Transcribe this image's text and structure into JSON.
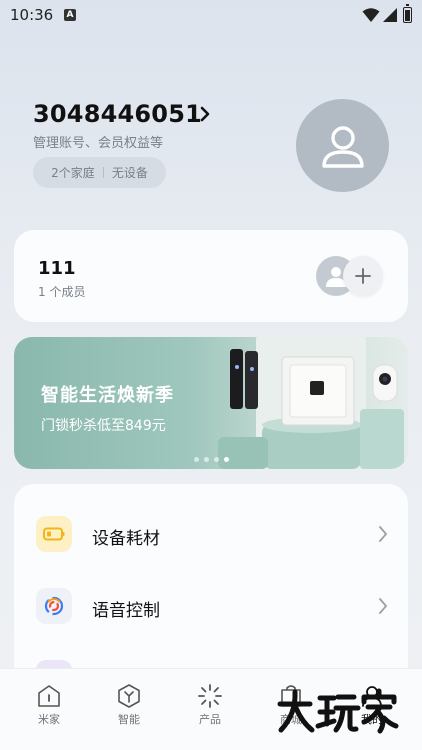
{
  "status_bar": {
    "time": "10:36",
    "indicator": "A"
  },
  "profile": {
    "account_id": "3048446051",
    "subtitle": "管理账号、会员权益等",
    "homes": "2个家庭",
    "devices": "无设备"
  },
  "family": {
    "name": "111",
    "members": "1 个成员"
  },
  "banner": {
    "title": "智能生活焕新季",
    "subtitle": "门锁秒杀低至849元",
    "page_count": 4,
    "active_page": 4
  },
  "menu": {
    "items": [
      {
        "label": "设备耗材",
        "icon": "consumables-icon",
        "icon_bg": "#fdf0c4"
      },
      {
        "label": "语音控制",
        "icon": "voice-assistant-icon",
        "icon_bg": "#eef1f8"
      }
    ]
  },
  "bottom_nav": {
    "items": [
      {
        "label": "米家",
        "icon": "home-icon"
      },
      {
        "label": "智能",
        "icon": "smart-icon"
      },
      {
        "label": "产品",
        "icon": "product-icon"
      },
      {
        "label": "商城",
        "icon": "store-icon"
      },
      {
        "label": "我的",
        "icon": "profile-icon"
      }
    ],
    "active_index": 4
  },
  "watermark": "大玩家",
  "colors": {
    "accent": "#111111",
    "muted": "#7a8088",
    "banner": "#9fc7bd",
    "consumables": "#f2b516"
  }
}
